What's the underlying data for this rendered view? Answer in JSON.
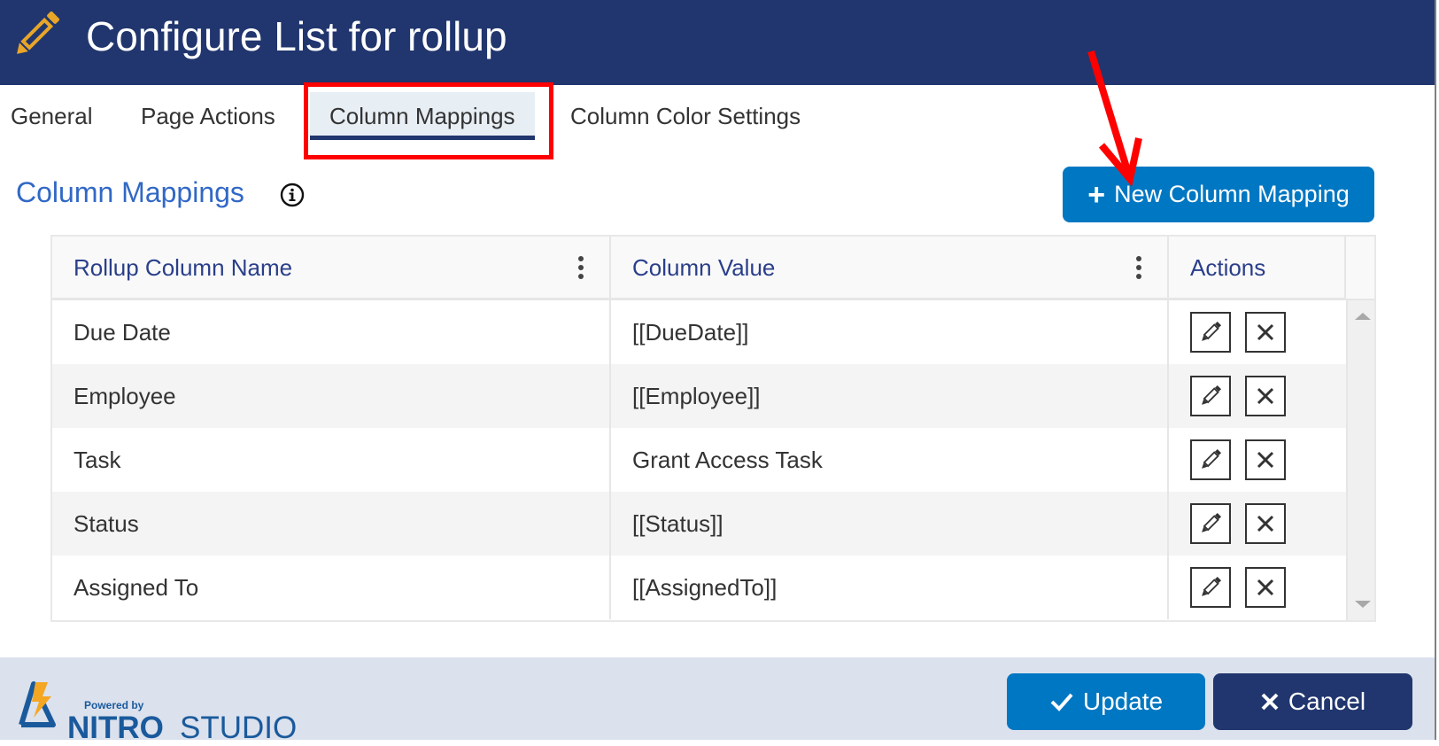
{
  "header": {
    "title": "Configure List for rollup",
    "icon": "pencil-icon",
    "colors": {
      "background": "#21366e",
      "icon": "#e8a628"
    }
  },
  "tabs": [
    {
      "label": "General",
      "active": false
    },
    {
      "label": "Page Actions",
      "active": false
    },
    {
      "label": "Column Mappings",
      "active": true
    },
    {
      "label": "Column Color Settings",
      "active": false
    }
  ],
  "section": {
    "title": "Column Mappings",
    "info_icon": "info-circle-icon",
    "new_button_label": "New Column Mapping",
    "new_button_icon": "plus-icon"
  },
  "grid": {
    "columns": [
      {
        "label": "Rollup Column Name",
        "has_menu": true
      },
      {
        "label": "Column Value",
        "has_menu": true
      },
      {
        "label": "Actions",
        "has_menu": false
      }
    ],
    "rows": [
      {
        "name": "Due Date",
        "value": "[[DueDate]]"
      },
      {
        "name": "Employee",
        "value": "[[Employee]]"
      },
      {
        "name": "Task",
        "value": "Grant Access Task"
      },
      {
        "name": "Status",
        "value": "[[Status]]"
      },
      {
        "name": "Assigned To",
        "value": "[[AssignedTo]]"
      }
    ],
    "row_actions": [
      "edit-pencil-icon",
      "delete-x-icon"
    ]
  },
  "footer": {
    "powered_by": "Powered by",
    "brand_bold": "NITRO",
    "brand_light": "STUDIO",
    "update_label": "Update",
    "cancel_label": "Cancel"
  },
  "colors": {
    "primary_button": "#0077c2",
    "secondary_button": "#21366e",
    "section_title": "#3168c6",
    "column_header": "#2a3f8a",
    "annotation_red": "#ff0000",
    "footer_bg": "#dbe1ed"
  }
}
